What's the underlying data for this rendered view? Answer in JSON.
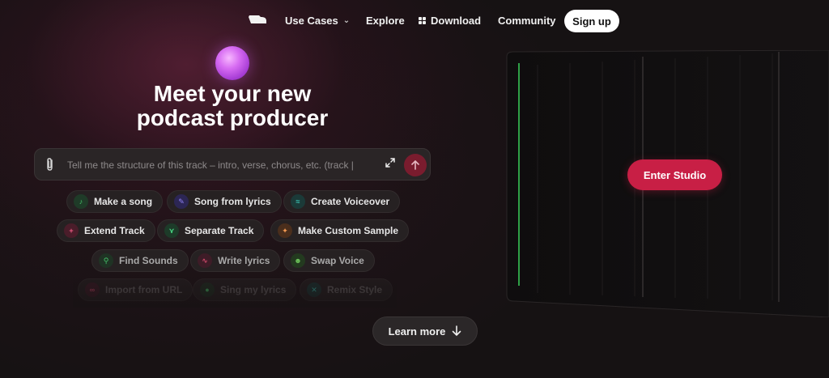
{
  "nav": {
    "logo_icon": "boat-logo-icon",
    "use_cases": "Use Cases",
    "explore": "Explore",
    "download": "Download",
    "community": "Community",
    "signup": "Sign up"
  },
  "hero": {
    "headline_line1": "Meet your new",
    "headline_line2": "podcast producer",
    "prompt_placeholder": "Tell me the structure of this track – intro, verse, chorus, etc. (track |"
  },
  "chips": [
    {
      "label": "Make a song",
      "icon": "music-note-icon",
      "color": "#3aa35a"
    },
    {
      "label": "Song from lyrics",
      "icon": "lyrics-icon",
      "color": "#6c5ce7"
    },
    {
      "label": "Create Voiceover",
      "icon": "voiceover-icon",
      "color": "#2bb3a3"
    },
    {
      "label": "Extend Track",
      "icon": "extend-icon",
      "color": "#e0436e"
    },
    {
      "label": "Separate Track",
      "icon": "separate-icon",
      "color": "#38c172"
    },
    {
      "label": "Make Custom Sample",
      "icon": "sparkle-icon",
      "color": "#f08a3c"
    },
    {
      "label": "Find Sounds",
      "icon": "search-icon",
      "color": "#3aa35a"
    },
    {
      "label": "Write lyrics",
      "icon": "pen-icon",
      "color": "#c0395a"
    },
    {
      "label": "Swap Voice",
      "icon": "user-swap-icon",
      "color": "#5fb04a"
    },
    {
      "label": "Import from URL",
      "icon": "link-icon",
      "color": "#c0395a"
    },
    {
      "label": "Sing my lyrics",
      "icon": "mic-icon",
      "color": "#3aa35a"
    },
    {
      "label": "Remix Style",
      "icon": "remix-icon",
      "color": "#2bb3a3"
    }
  ],
  "learn_more": "Learn more",
  "studio": {
    "enter_label": "Enter Studio",
    "accent": "#c81f45",
    "playhead_color": "#3ad15a"
  }
}
